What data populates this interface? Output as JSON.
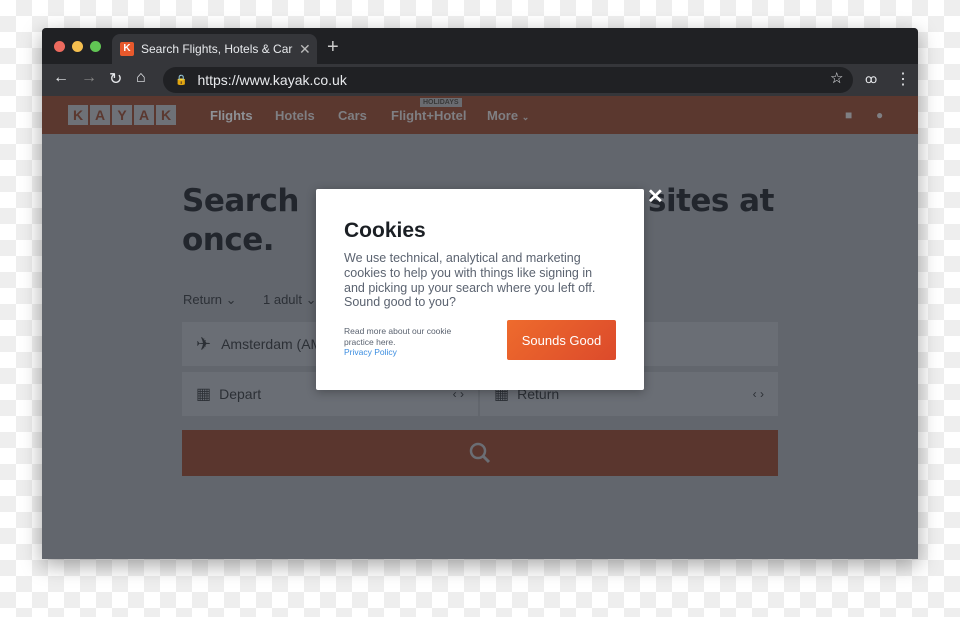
{
  "browser": {
    "tab_title": "Search Flights, Hotels & Car Hire",
    "favicon_letter": "K",
    "url": "https://www.kayak.co.uk",
    "traffic_colors": [
      "#ed6a5e",
      "#f5bf4f",
      "#61c554"
    ]
  },
  "site": {
    "logo_letters": [
      "K",
      "A",
      "Y",
      "A",
      "K"
    ],
    "nav": [
      {
        "label": "Flights"
      },
      {
        "label": "Hotels"
      },
      {
        "label": "Cars"
      },
      {
        "label": "Flight+Hotel",
        "badge": "HOLIDAYS"
      },
      {
        "label": "More"
      }
    ]
  },
  "hero": {
    "heading_part1": "Search",
    "heading_part2": "sites at",
    "heading_line2": "once."
  },
  "search": {
    "trip_type": "Return",
    "travellers": "1 adult",
    "origin": "Amsterdam (AM",
    "depart": "Depart",
    "return": "Return"
  },
  "cookies": {
    "title": "Cookies",
    "body": "We use technical, analytical and marketing cookies to help you with things like signing in and picking up your search where you left off. Sound good to you?",
    "note": "Read more about our cookie practice here.",
    "privacy_link": "Privacy Policy",
    "accept": "Sounds Good",
    "accent": "#e8592c"
  }
}
